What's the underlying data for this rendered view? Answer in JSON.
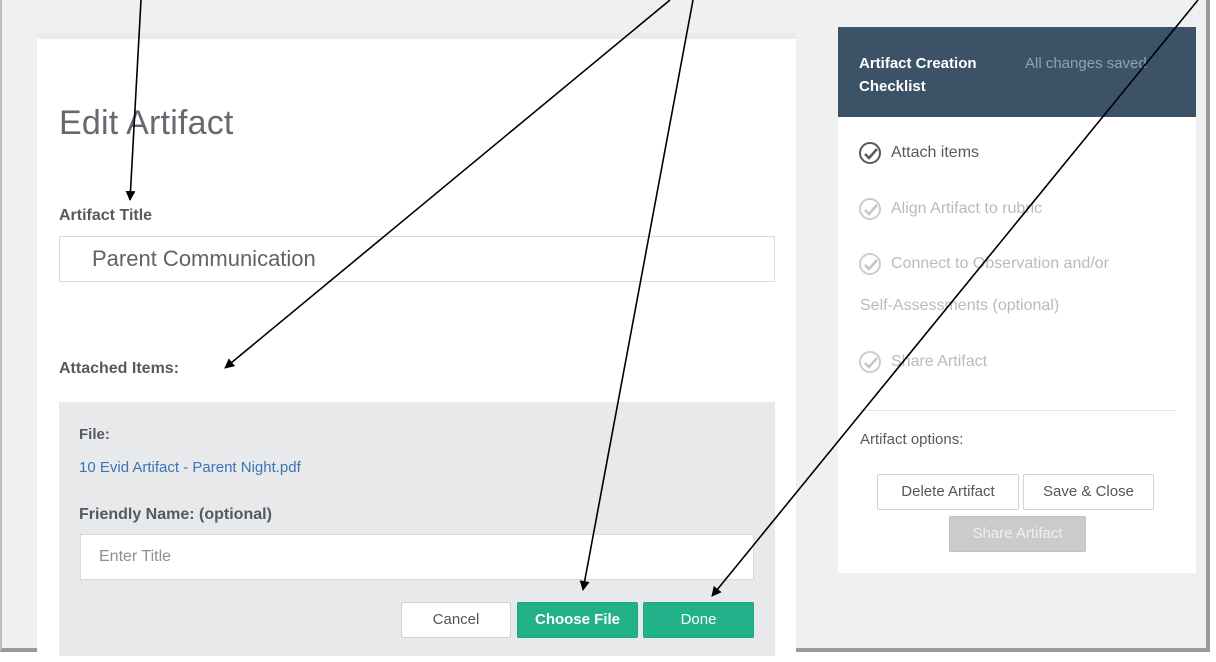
{
  "edit": {
    "page_title": "Edit Artifact",
    "artifact_title_label": "Artifact Title",
    "artifact_title_value": "Parent Communication",
    "attached_items_label": "Attached Items:",
    "file_label": "File:",
    "file_name": "10 Evid Artifact - Parent Night.pdf",
    "friendly_name_label": "Friendly Name: (optional)",
    "friendly_name_placeholder": "Enter Title",
    "cancel_label": "Cancel",
    "choose_file_label": "Choose File",
    "done_label": "Done"
  },
  "checklist": {
    "title": "Artifact Creation Checklist",
    "status": "All changes saved",
    "items": [
      {
        "label": "Attach items",
        "state": "complete"
      },
      {
        "label": "Align Artifact to rubric",
        "state": "incomplete"
      },
      {
        "label": "Connect to Observation and/or",
        "label_line2": "Self-Assessments (optional)",
        "state": "incomplete"
      },
      {
        "label": "Share Artifact",
        "state": "incomplete"
      }
    ],
    "options_label": "Artifact options:",
    "delete_label": "Delete Artifact",
    "save_close_label": "Save & Close",
    "share_label": "Share Artifact"
  },
  "icons": {
    "check": "check-circle-icon",
    "arrow": "annotation-arrow"
  },
  "colors": {
    "header_bg": "#3b5267",
    "primary_green": "#21b289",
    "link_blue": "#3a74b8",
    "attached_bg": "#e7e9eb"
  }
}
